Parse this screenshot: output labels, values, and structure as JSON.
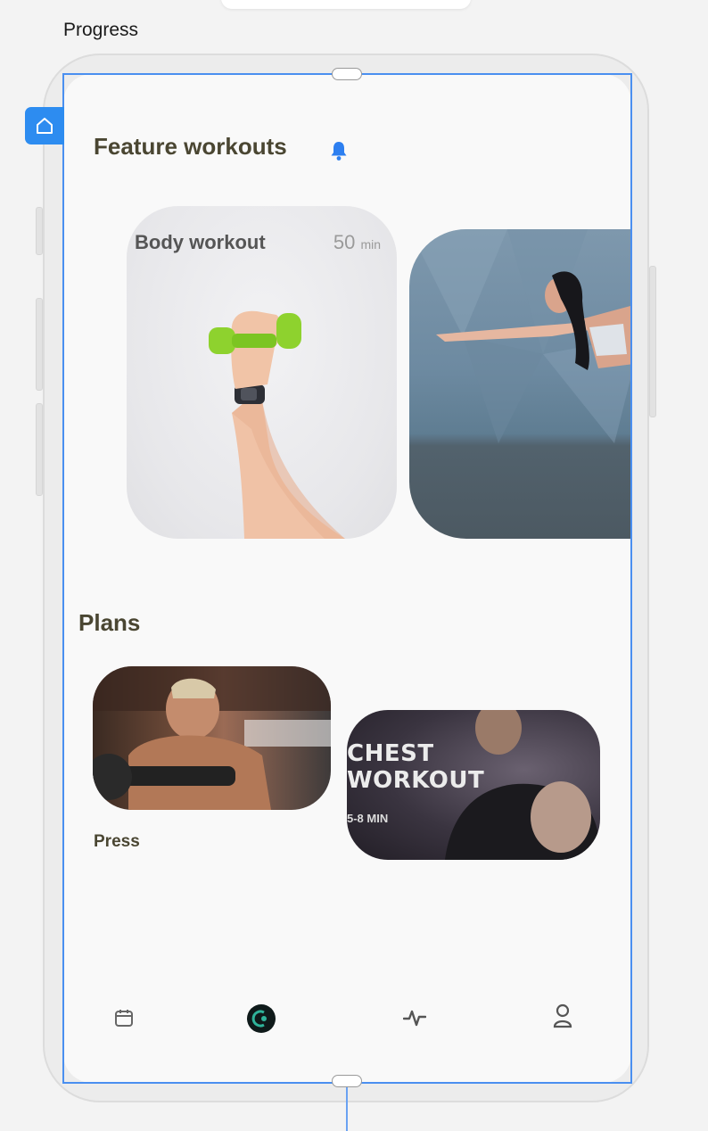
{
  "frame": {
    "label": "Progress"
  },
  "sections": {
    "feature_title": "Feature workouts",
    "plans_title": "Plans"
  },
  "featured_cards": [
    {
      "title": "Body workout",
      "duration_value": "50",
      "duration_unit": "min"
    },
    {
      "title": ""
    }
  ],
  "plans": [
    {
      "label": "Press"
    },
    {
      "overlay_line1": "CHEST",
      "overlay_line2": "WORKOUT",
      "overlay_line3": "5-8 MIN"
    }
  ],
  "nav": {
    "items": [
      "calendar-icon",
      "app-logo-icon",
      "activity-icon",
      "profile-icon"
    ]
  },
  "colors": {
    "heading": "#4a4632",
    "accent": "#2d8cf0",
    "selection": "#4a8ff0"
  },
  "icons": {
    "home_badge": "home-icon",
    "bell": "bell-icon"
  }
}
